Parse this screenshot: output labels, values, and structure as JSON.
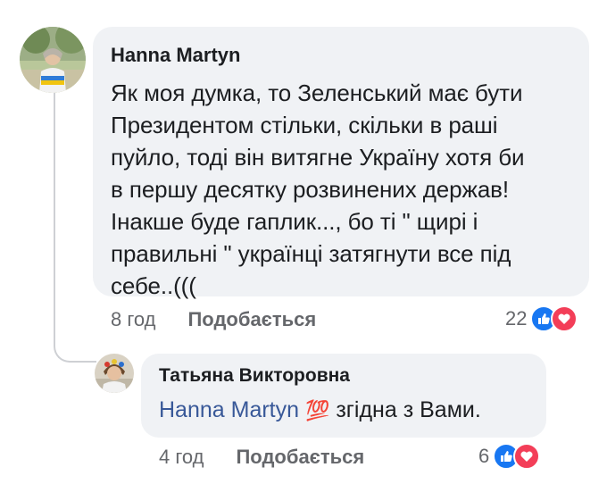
{
  "comment": {
    "author": "Hanna Martyn",
    "text_lines": [
      "Як моя думка, то Зеленський має бути",
      "Президентом стільки, скільки в раші",
      "пуйло, тоді він витягне Україну хотя би",
      "в першу десятку розвинених держав!",
      "Інакше буде гаплик..., бо ті \" щирі і",
      "правильні \" українці затягнути все під",
      "себе..((("
    ],
    "time": "8 год",
    "like_label": "Подобається",
    "reaction_count": "22",
    "reactions": [
      "like-icon",
      "love-icon"
    ]
  },
  "reply": {
    "author": "Татьяна Викторовна",
    "mention": "Hanna Martyn",
    "emoji": "💯",
    "text": " згідна з Вами.",
    "time": "4 год",
    "like_label": "Подобається",
    "reaction_count": "6",
    "reactions": [
      "like-icon",
      "love-icon"
    ]
  },
  "colors": {
    "bubble": "#f0f2f5",
    "mention": "#385898",
    "like": "#1877f2",
    "love": "#f33e58",
    "meta": "#65676b"
  }
}
